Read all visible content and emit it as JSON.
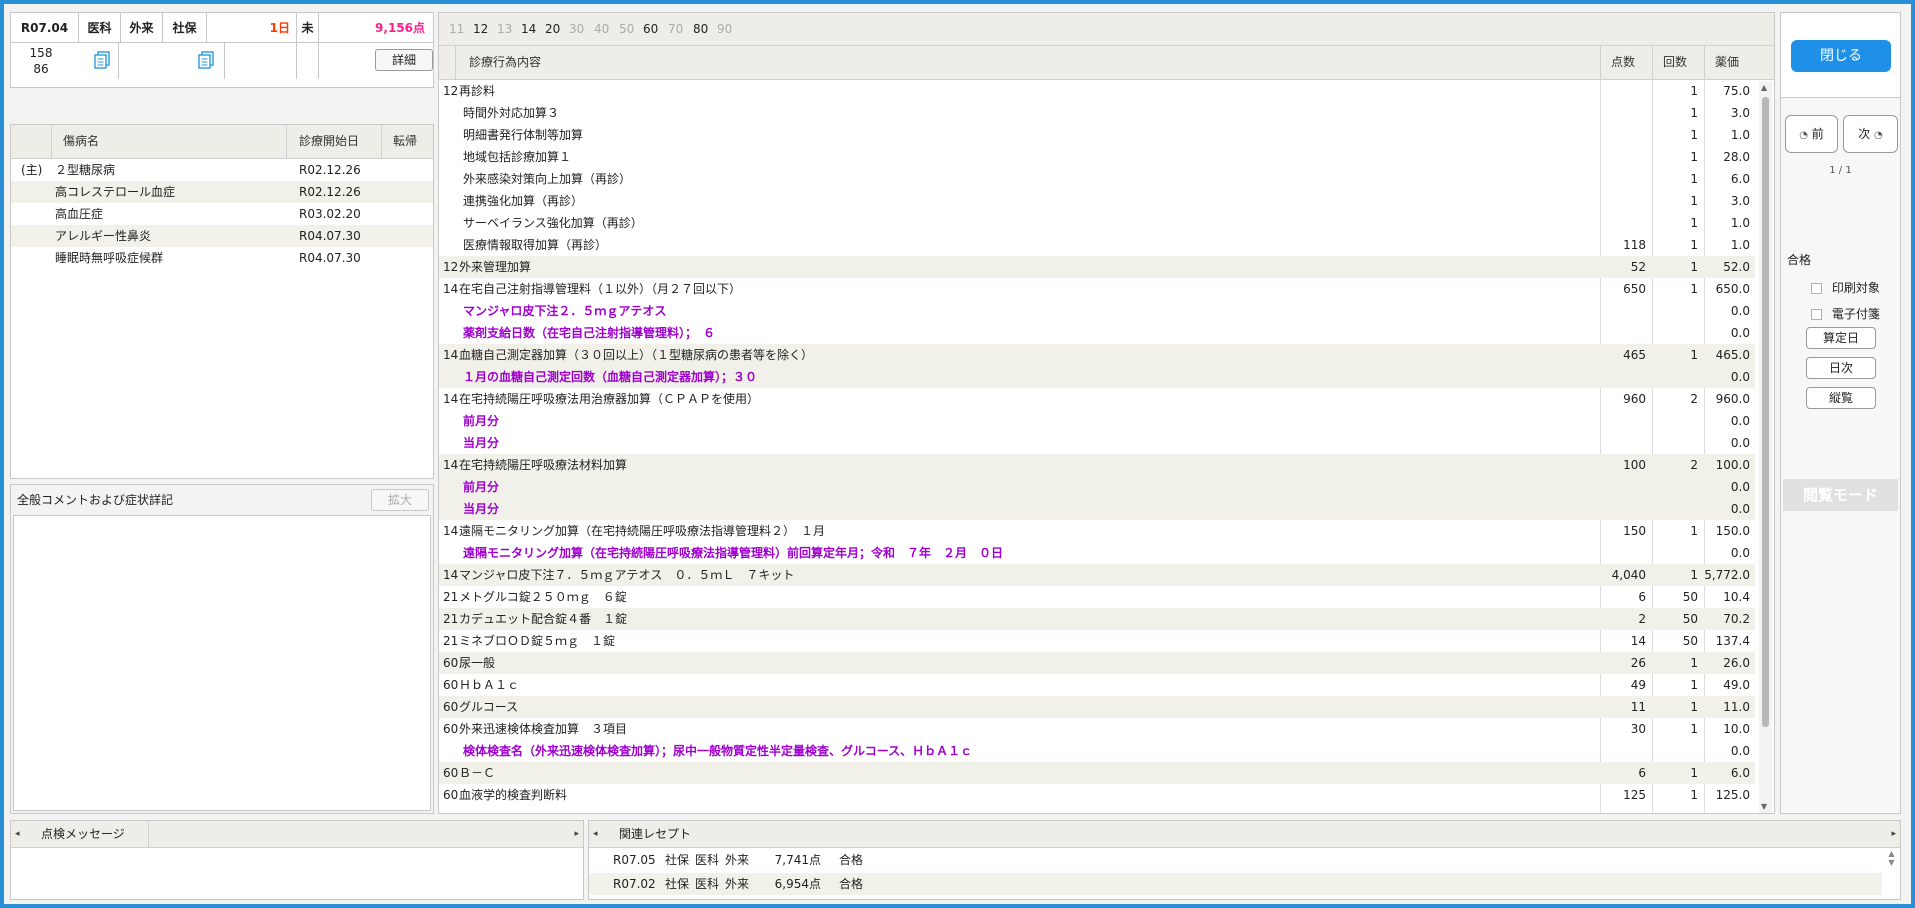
{
  "header": {
    "month": "R07.04",
    "dept": "医科",
    "visit_type": "外来",
    "insurance": "社保",
    "days": "1日",
    "status": "未",
    "points": "9,156点",
    "id_line1": "158",
    "id_line2": "86",
    "detail_label": "詳細"
  },
  "disease_table": {
    "headers": [
      "傷病名",
      "診療開始日",
      "転帰"
    ],
    "rows": [
      {
        "mark": "(主)",
        "name": "２型糖尿病",
        "date": "R02.12.26"
      },
      {
        "mark": "",
        "name": "高コレステロール血症",
        "date": "R02.12.26"
      },
      {
        "mark": "",
        "name": "高血圧症",
        "date": "R03.02.20"
      },
      {
        "mark": "",
        "name": "アレルギー性鼻炎",
        "date": "R04.07.30"
      },
      {
        "mark": "",
        "name": "睡眠時無呼吸症候群",
        "date": "R04.07.30"
      }
    ]
  },
  "comment": {
    "title": "全般コメントおよび症状詳記",
    "expand_label": "拡大"
  },
  "tabs": [
    {
      "label": "11",
      "active": false
    },
    {
      "label": "12",
      "active": true
    },
    {
      "label": "13",
      "active": false
    },
    {
      "label": "14",
      "active": true
    },
    {
      "label": "20",
      "active": true
    },
    {
      "label": "30",
      "active": false
    },
    {
      "label": "40",
      "active": false
    },
    {
      "label": "50",
      "active": false
    },
    {
      "label": "60",
      "active": true
    },
    {
      "label": "70",
      "active": false
    },
    {
      "label": "80",
      "active": true
    },
    {
      "label": "90",
      "active": false
    }
  ],
  "main_headers": {
    "content": "診療行為内容",
    "points": "点数",
    "count": "回数",
    "price": "薬価"
  },
  "main_rows": [
    {
      "code": "12",
      "name": "再診料",
      "indent": false,
      "purple": false,
      "points": "",
      "count": "1",
      "price": "75.0",
      "alt": false
    },
    {
      "code": "",
      "name": "時間外対応加算３",
      "indent": true,
      "purple": false,
      "points": "",
      "count": "1",
      "price": "3.0",
      "alt": false
    },
    {
      "code": "",
      "name": "明細書発行体制等加算",
      "indent": true,
      "purple": false,
      "points": "",
      "count": "1",
      "price": "1.0",
      "alt": false
    },
    {
      "code": "",
      "name": "地域包括診療加算１",
      "indent": true,
      "purple": false,
      "points": "",
      "count": "1",
      "price": "28.0",
      "alt": false
    },
    {
      "code": "",
      "name": "外来感染対策向上加算（再診）",
      "indent": true,
      "purple": false,
      "points": "",
      "count": "1",
      "price": "6.0",
      "alt": false
    },
    {
      "code": "",
      "name": "連携強化加算（再診）",
      "indent": true,
      "purple": false,
      "points": "",
      "count": "1",
      "price": "3.0",
      "alt": false
    },
    {
      "code": "",
      "name": "サーベイランス強化加算（再診）",
      "indent": true,
      "purple": false,
      "points": "",
      "count": "1",
      "price": "1.0",
      "alt": false
    },
    {
      "code": "",
      "name": "医療情報取得加算（再診）",
      "indent": true,
      "purple": false,
      "points": "118",
      "count": "1",
      "price": "1.0",
      "alt": false
    },
    {
      "code": "12",
      "name": "外来管理加算",
      "indent": false,
      "purple": false,
      "points": "52",
      "count": "1",
      "price": "52.0",
      "alt": true
    },
    {
      "code": "14",
      "name": "在宅自己注射指導管理料（１以外）（月２７回以下）",
      "indent": false,
      "purple": false,
      "points": "650",
      "count": "1",
      "price": "650.0",
      "alt": false
    },
    {
      "code": "",
      "name": "マンジャロ皮下注２．５ｍｇアテオス",
      "indent": true,
      "purple": true,
      "points": "",
      "count": "",
      "price": "0.0",
      "alt": false
    },
    {
      "code": "",
      "name": "薬剤支給日数（在宅自己注射指導管理料）；　６",
      "indent": true,
      "purple": true,
      "points": "",
      "count": "",
      "price": "0.0",
      "alt": false
    },
    {
      "code": "14",
      "name": "血糖自己測定器加算（３０回以上）（１型糖尿病の患者等を除く）",
      "indent": false,
      "purple": false,
      "points": "465",
      "count": "1",
      "price": "465.0",
      "alt": true
    },
    {
      "code": "",
      "name": "１月の血糖自己測定回数（血糖自己測定器加算）；３０",
      "indent": true,
      "purple": true,
      "points": "",
      "count": "",
      "price": "0.0",
      "alt": true
    },
    {
      "code": "14",
      "name": "在宅持続陽圧呼吸療法用治療器加算（ＣＰＡＰを使用）",
      "indent": false,
      "purple": false,
      "points": "960",
      "count": "2",
      "price": "960.0",
      "alt": false
    },
    {
      "code": "",
      "name": "前月分",
      "indent": true,
      "purple": true,
      "points": "",
      "count": "",
      "price": "0.0",
      "alt": false
    },
    {
      "code": "",
      "name": "当月分",
      "indent": true,
      "purple": true,
      "points": "",
      "count": "",
      "price": "0.0",
      "alt": false
    },
    {
      "code": "14",
      "name": "在宅持続陽圧呼吸療法材料加算",
      "indent": false,
      "purple": false,
      "points": "100",
      "count": "2",
      "price": "100.0",
      "alt": true
    },
    {
      "code": "",
      "name": "前月分",
      "indent": true,
      "purple": true,
      "points": "",
      "count": "",
      "price": "0.0",
      "alt": true
    },
    {
      "code": "",
      "name": "当月分",
      "indent": true,
      "purple": true,
      "points": "",
      "count": "",
      "price": "0.0",
      "alt": true
    },
    {
      "code": "14",
      "name": "遠隔モニタリング加算（在宅持続陽圧呼吸療法指導管理料２）　１月",
      "indent": false,
      "purple": false,
      "points": "150",
      "count": "1",
      "price": "150.0",
      "alt": false
    },
    {
      "code": "",
      "name": "遠隔モニタリング加算（在宅持続陽圧呼吸療法指導管理料）前回算定年月；令和　７年　２月　０日",
      "indent": true,
      "purple": true,
      "points": "",
      "count": "",
      "price": "0.0",
      "alt": false
    },
    {
      "code": "14",
      "name": "マンジャロ皮下注７．５ｍｇアテオス　０．５ｍＬ　７キット",
      "indent": false,
      "purple": false,
      "points": "4,040",
      "count": "1",
      "price": "5,772.0",
      "alt": true
    },
    {
      "code": "21",
      "name": "メトグルコ錠２５０ｍｇ　６錠",
      "indent": false,
      "purple": false,
      "points": "6",
      "count": "50",
      "price": "10.4",
      "alt": false
    },
    {
      "code": "21",
      "name": "カデュエット配合錠４番　１錠",
      "indent": false,
      "purple": false,
      "points": "2",
      "count": "50",
      "price": "70.2",
      "alt": true
    },
    {
      "code": "21",
      "name": "ミネブロＯＤ錠５ｍｇ　１錠",
      "indent": false,
      "purple": false,
      "points": "14",
      "count": "50",
      "price": "137.4",
      "alt": false
    },
    {
      "code": "60",
      "name": "尿一般",
      "indent": false,
      "purple": false,
      "points": "26",
      "count": "1",
      "price": "26.0",
      "alt": true
    },
    {
      "code": "60",
      "name": "ＨｂＡ１ｃ",
      "indent": false,
      "purple": false,
      "points": "49",
      "count": "1",
      "price": "49.0",
      "alt": false
    },
    {
      "code": "60",
      "name": "グルコース",
      "indent": false,
      "purple": false,
      "points": "11",
      "count": "1",
      "price": "11.0",
      "alt": true
    },
    {
      "code": "60",
      "name": "外来迅速検体検査加算　３項目",
      "indent": false,
      "purple": false,
      "points": "30",
      "count": "1",
      "price": "10.0",
      "alt": false
    },
    {
      "code": "",
      "name": "検体検査名（外来迅速検体検査加算）；尿中一般物質定性半定量検査、グルコース、ＨｂＡ１ｃ",
      "indent": true,
      "purple": true,
      "points": "",
      "count": "",
      "price": "0.0",
      "alt": false
    },
    {
      "code": "60",
      "name": "Ｂ－Ｃ",
      "indent": false,
      "purple": false,
      "points": "6",
      "count": "1",
      "price": "6.0",
      "alt": true
    },
    {
      "code": "60",
      "name": "血液学的検査判断料",
      "indent": false,
      "purple": false,
      "points": "125",
      "count": "1",
      "price": "125.0",
      "alt": false
    }
  ],
  "right_panel": {
    "close_label": "閉じる",
    "prev_label": "前",
    "next_label": "次",
    "page": "1 / 1",
    "result": "合格",
    "print_label": "印刷対象",
    "eattach_label": "電子付箋",
    "calc_day_label": "算定日",
    "daily_label": "日次",
    "vertical_label": "縦覧",
    "mode_label": "閲覧モード"
  },
  "message_panel": {
    "title": "点検メッセージ"
  },
  "related_panel": {
    "title": "関連レセプト",
    "rows": [
      {
        "month": "R07.05",
        "ins": "社保",
        "dept": "医科",
        "type": "外来",
        "points": "7,741点",
        "result": "合格"
      },
      {
        "month": "R07.02",
        "ins": "社保",
        "dept": "医科",
        "type": "外来",
        "points": "6,954点",
        "result": "合格"
      }
    ]
  }
}
